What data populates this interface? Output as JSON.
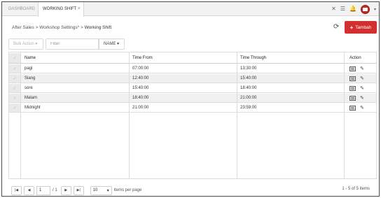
{
  "tabs": [
    {
      "label": "DASHBOARD"
    },
    {
      "label": "WORKING SHIFT",
      "close": "×"
    }
  ],
  "topbar": {
    "icons": [
      "expand-icon",
      "menu-icon",
      "bell-icon",
      "user-avatar",
      "chevron-down-icon"
    ]
  },
  "breadcrumb": {
    "items": [
      "After Sales",
      "Workshop Settings*",
      "Working Shift"
    ],
    "separator": ">"
  },
  "toolbar": {
    "bulk_label": "Bulk Action",
    "filter_placeholder": "Filter",
    "filter_field": "NAME",
    "add_label": "Tambah"
  },
  "table": {
    "columns": [
      "Name",
      "Time From",
      "Time Through",
      "Action"
    ],
    "rows": [
      {
        "name": "pagi",
        "from": "07:00:00",
        "through": "13:30:00"
      },
      {
        "name": "Siang",
        "from": "12:40:00",
        "through": "15:40:00"
      },
      {
        "name": "sore",
        "from": "15:40:00",
        "through": "18:40:00"
      },
      {
        "name": "Malam",
        "from": "18:40:00",
        "through": "21:00:00"
      },
      {
        "name": "Midnight",
        "from": "21:00:00",
        "through": "23:59:00"
      }
    ]
  },
  "pager": {
    "page": "1",
    "total_pages": "/ 1",
    "page_size": "10",
    "page_size_label": "items per page",
    "info": "1 - 5 of 5 items"
  },
  "colors": {
    "accent": "#d32f2f"
  }
}
